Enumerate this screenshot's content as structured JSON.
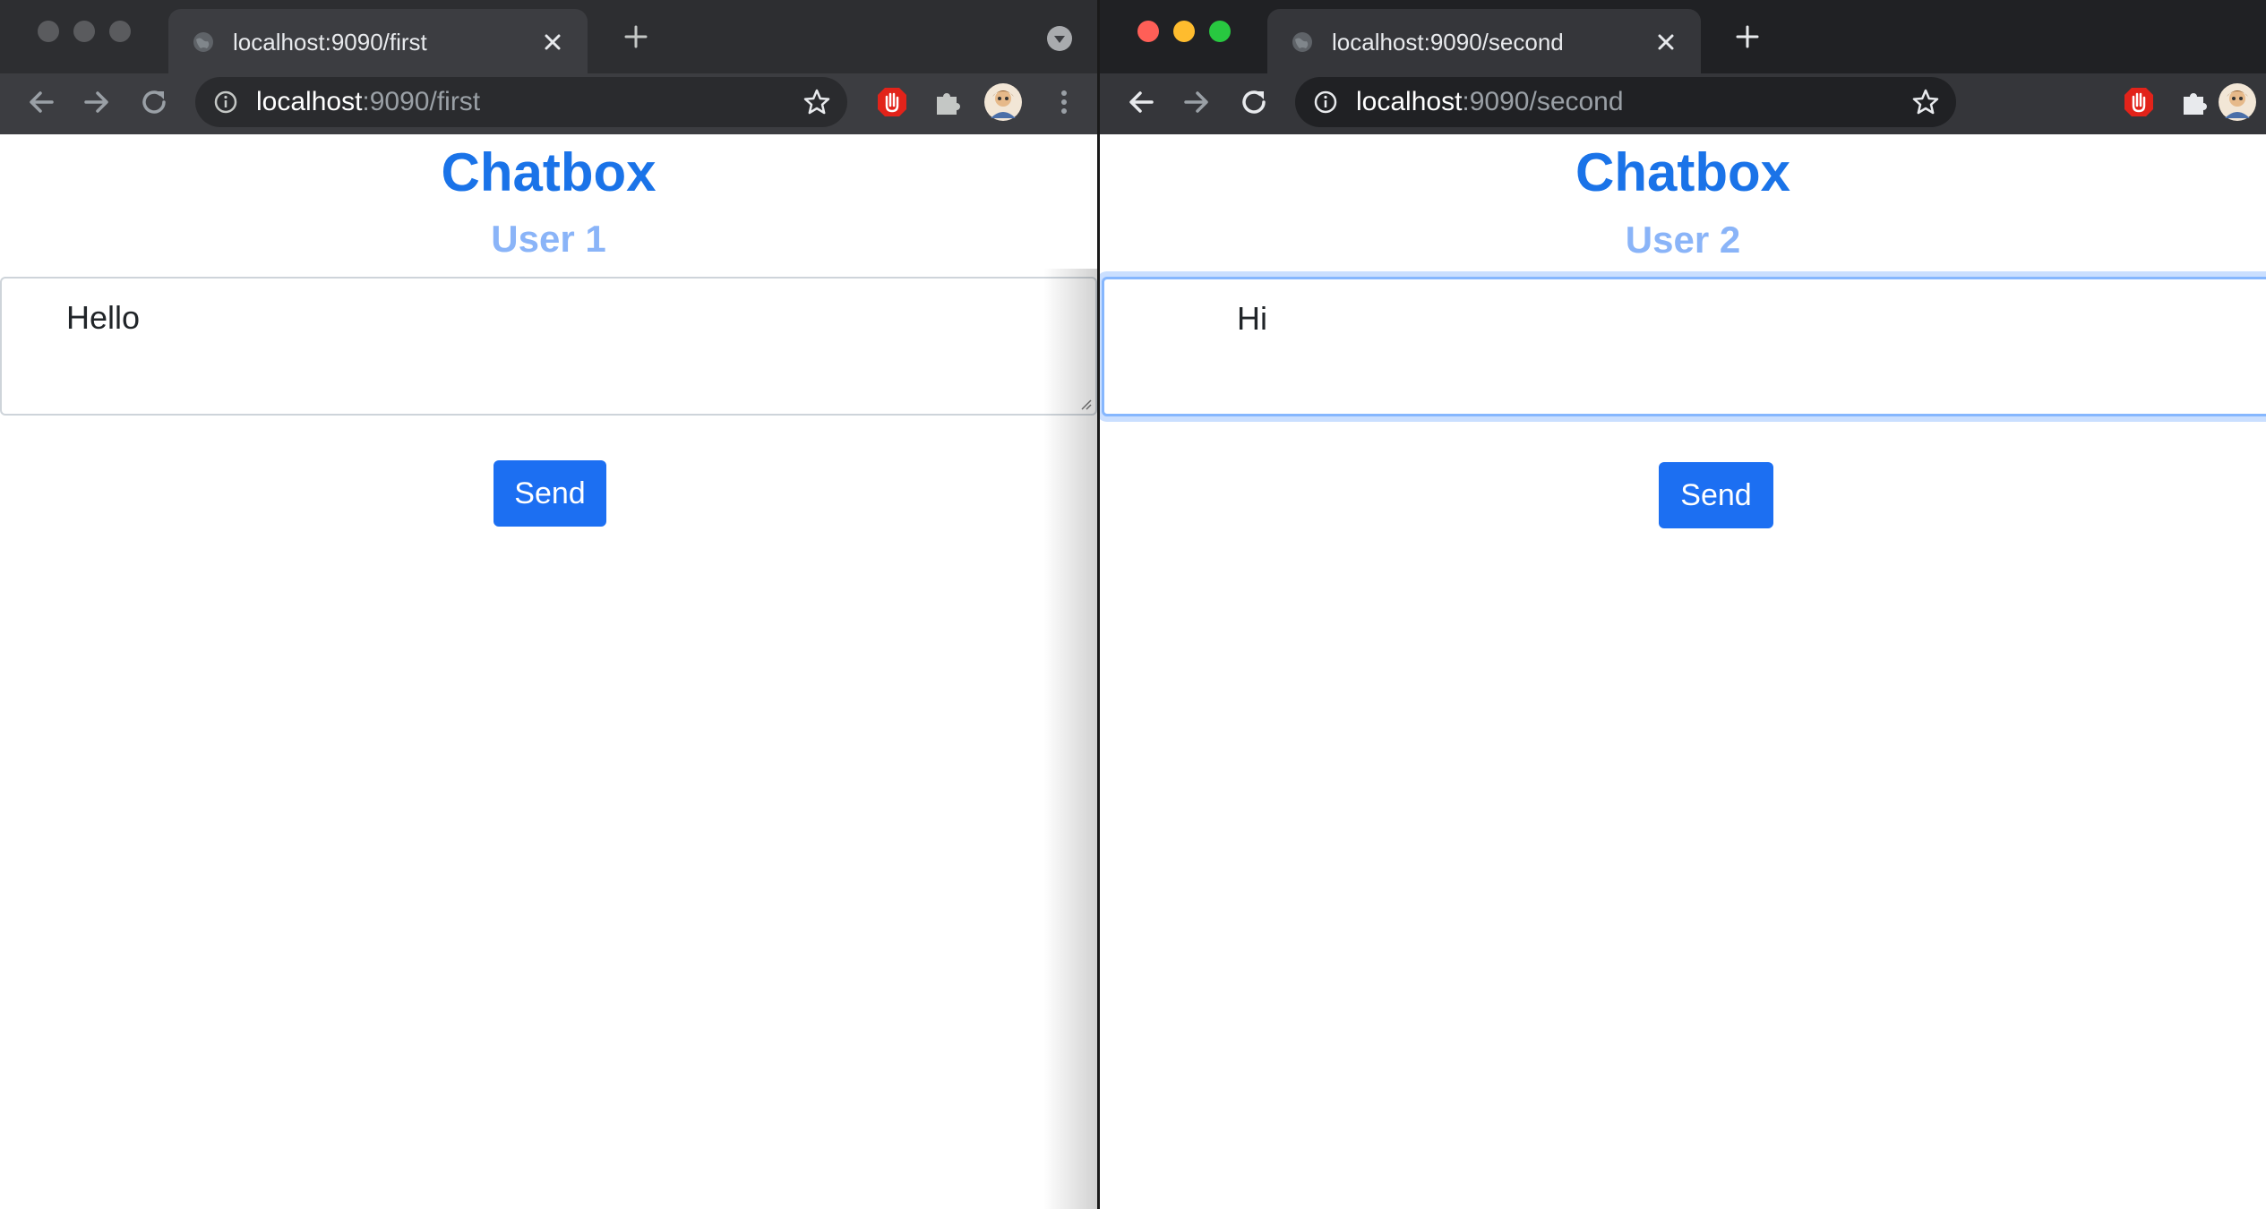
{
  "windows": [
    {
      "tab_title": "localhost:9090/first",
      "url_host": "localhost",
      "url_path": ":9090/first",
      "heading": "Chatbox",
      "subheading": "User 1",
      "message_value": "Hello",
      "send_label": "Send"
    },
    {
      "tab_title": "localhost:9090/second",
      "url_host": "localhost",
      "url_path": ":9090/second",
      "heading": "Chatbox",
      "subheading": "User 2",
      "message_value": "Hi",
      "send_label": "Send"
    }
  ],
  "colors": {
    "accent": "#1a73e8",
    "subheading": "#8ab4f8",
    "button": "#1c6ff2",
    "close_light": "#ff5f57",
    "minimize_light": "#febc2e",
    "zoom_light": "#28c840"
  },
  "icons": [
    "globe-icon",
    "close-icon",
    "plus-icon",
    "back-arrow-icon",
    "forward-arrow-icon",
    "reload-icon",
    "info-icon",
    "star-icon",
    "adblock-icon",
    "puzzle-icon",
    "avatar",
    "kebab-menu-icon",
    "tab-search-icon"
  ]
}
